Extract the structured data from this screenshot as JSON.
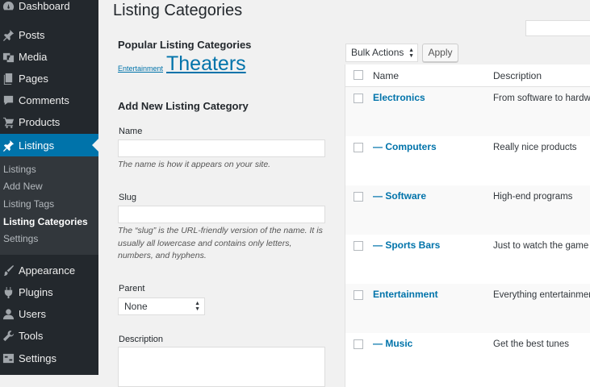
{
  "sidebar": {
    "items": [
      {
        "label": "Dashboard",
        "icon": "dashboard-icon"
      },
      {
        "label": "Posts",
        "icon": "pin-icon"
      },
      {
        "label": "Media",
        "icon": "media-icon"
      },
      {
        "label": "Pages",
        "icon": "pages-icon"
      },
      {
        "label": "Comments",
        "icon": "comment-icon"
      },
      {
        "label": "Products",
        "icon": "cart-icon"
      },
      {
        "label": "Listings",
        "icon": "pin-icon"
      },
      {
        "label": "Appearance",
        "icon": "brush-icon"
      },
      {
        "label": "Plugins",
        "icon": "plug-icon"
      },
      {
        "label": "Users",
        "icon": "user-icon"
      },
      {
        "label": "Tools",
        "icon": "wrench-icon"
      },
      {
        "label": "Settings",
        "icon": "settings-icon"
      }
    ],
    "submenu": [
      "Listings",
      "Add New",
      "Listing Tags",
      "Listing Categories",
      "Settings"
    ]
  },
  "page": {
    "title": "Listing Categories"
  },
  "popular": {
    "heading": "Popular Listing Categories",
    "tags": [
      "Entertainment",
      "Theaters"
    ]
  },
  "form": {
    "heading": "Add New Listing Category",
    "name_label": "Name",
    "name_help": "The name is how it appears on your site.",
    "slug_label": "Slug",
    "slug_help": "The “slug” is the URL-friendly version of the name. It is usually all lowercase and contains only letters, numbers, and hyphens.",
    "parent_label": "Parent",
    "parent_value": "None",
    "description_label": "Description"
  },
  "table": {
    "bulk_actions": "Bulk Actions",
    "apply": "Apply",
    "col_name": "Name",
    "col_description": "Description",
    "rows": [
      {
        "name": "Electronics",
        "description": "From software to hardware"
      },
      {
        "name": "— Computers",
        "description": "Really nice products"
      },
      {
        "name": "— Software",
        "description": "High-end programs"
      },
      {
        "name": "— Sports Bars",
        "description": "Just to watch the game"
      },
      {
        "name": "Entertainment",
        "description": "Everything entertainment"
      },
      {
        "name": "— Music",
        "description": "Get the best tunes"
      }
    ]
  },
  "colors": {
    "sidebar_bg": "#23282d",
    "active": "#0073aa",
    "link": "#0073aa"
  }
}
